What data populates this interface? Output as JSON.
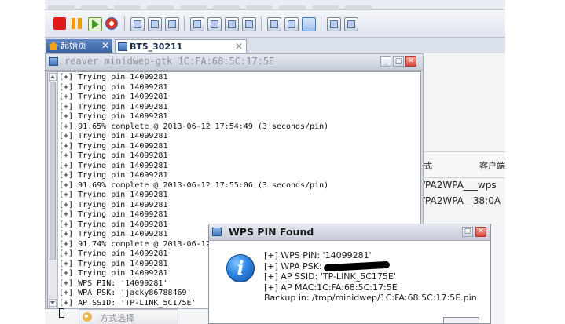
{
  "tabs": [
    {
      "label": "起始页",
      "close": "✕",
      "icon": "home-icon"
    },
    {
      "label": "BT5_30211",
      "close": "✕",
      "icon": "vm-icon"
    }
  ],
  "toolbar": {
    "icons": [
      "stop-icon",
      "pause-icon",
      "play-icon",
      "reset-icon",
      "snapshot-icon",
      "snapshot-manager-icon",
      "revert-snapshot-icon",
      "console-view-icon",
      "fullscreen-icon",
      "unity-icon",
      "thumbnail-icon",
      "library-icon",
      "prefs-icon",
      "settings-icon",
      "help-icon",
      "devices-icon"
    ]
  },
  "reaver_window": {
    "title": "reaver minidwep-gtk 1C:FA:68:5C:17:5E",
    "buttons": {
      "minimize": "_",
      "maximize": "□",
      "close": "✕"
    },
    "lines": [
      "[+] Trying pin 14099281",
      "[+] Trying pin 14099281",
      "[+] Trying pin 14099281",
      "[+] Trying pin 14099281",
      "[+] Trying pin 14099281",
      "[+] 91.65% complete @ 2013-06-12 17:54:49 (3 seconds/pin)",
      "[+] Trying pin 14099281",
      "[+] Trying pin 14099281",
      "[+] Trying pin 14099281",
      "[+] Trying pin 14099281",
      "[+] Trying pin 14099281",
      "[+] 91.69% complete @ 2013-06-12 17:55:06 (3 seconds/pin)",
      "[+] Trying pin 14099281",
      "[+] Trying pin 14099281",
      "[+] Trying pin 14099281",
      "[+] Trying pin 14099281",
      "[+] Trying pin 14099281",
      "[+] 91.74% complete @ 2013-06-12",
      "[+] Trying pin 14099281",
      "[+] Trying pin 14099281",
      "[+] Trying pin 14099281",
      "[+] WPS PIN: '14099281'",
      "[+] WPA PSK: 'jacky86788469'",
      "[+] AP SSID: 'TP-LINK_5C175E'"
    ]
  },
  "right_panel": {
    "col1": "式",
    "col2": "客户端",
    "rows": [
      "/PA2WPA___wps",
      "/PA2WPA__38:0A"
    ]
  },
  "bottom_control": {
    "label": "方式选择"
  },
  "dialog": {
    "title": "WPS PIN Found",
    "buttons": {
      "maximize": "□",
      "close": "✕"
    },
    "info_glyph": "i",
    "pin_line": "[+] WPS PIN: '14099281'",
    "psk_label": "[+] WPA PSK:",
    "ssid_line": "[+] AP SSID: 'TP-LINK_5C175E'",
    "mac_line": "[+] AP MAC:1C:FA:68:5C:17:5E",
    "backup_line": "Backup in: /tmp/minidwep/1C:FA:68:5C:17:5E.pin"
  }
}
